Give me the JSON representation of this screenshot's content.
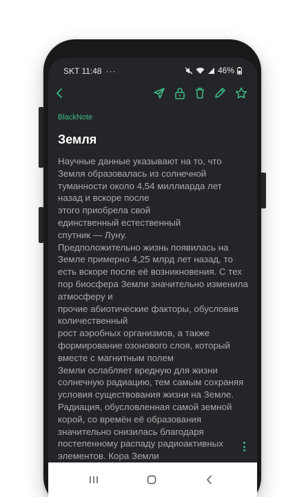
{
  "status_bar": {
    "time": "SKT 11:48",
    "more": "···",
    "battery": "46%"
  },
  "toolbar": {
    "icons": [
      "back-icon",
      "send-icon",
      "lock-icon",
      "trash-icon",
      "edit-icon",
      "star-icon"
    ],
    "accent_color": "#3fb984"
  },
  "note": {
    "app_label": "BlackNote",
    "title": "Земля",
    "body": "Научные данные указывают на то, что Земля образовалась из солнечной туманности около 4,54 миллиарда лет назад и вскоре после\nэтого приобрела свой\nединственный естественный\nспутник — Луну.\nПредположительно жизнь появилась на Земле примерно 4,25 млрд лет назад, то есть вскоре после её возникновения. С тех пор биосфера Земли значительно изменила атмосферу и\nпрочие абиотические факторы, обусловив количественный\nрост аэробных организмов, а также формирование озонового слоя, который вместе с магнитным полем\nЗемли ослабляет вредную для жизни солнечную радиацию, тем самым сохраняя условия существования жизни на Земле. Радиация, обусловленная самой земной корой, со времён её образования значительно снизилась благодаря постепенному распаду радиоактивных элементов. Кора Земли"
  },
  "navbar": {
    "icons": [
      "recent-apps-icon",
      "home-icon",
      "back-nav-icon"
    ]
  }
}
